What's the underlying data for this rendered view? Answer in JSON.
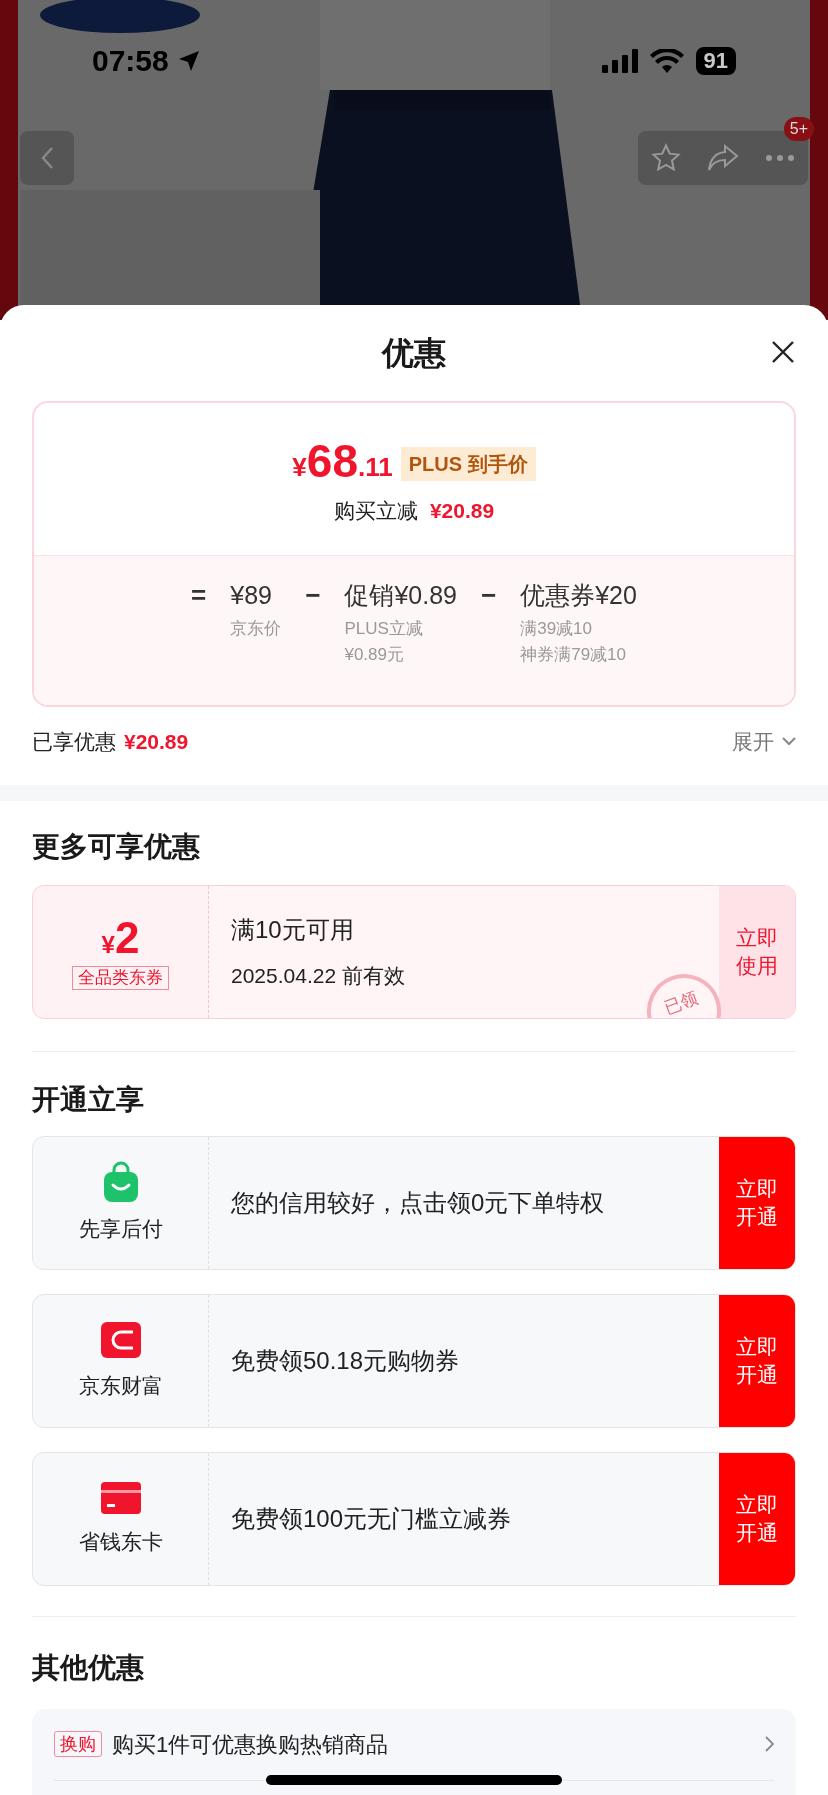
{
  "status_bar": {
    "time": "07:58",
    "battery": "91"
  },
  "nav": {
    "badge": "5+"
  },
  "sheet": {
    "title": "优惠"
  },
  "price_card": {
    "currency": "¥",
    "price_int": "68",
    "price_dec": ".11",
    "price_tag": "PLUS 到手价",
    "reduction_label": "购买立减",
    "reduction": "¥20.89",
    "breakdown": [
      {
        "op": "=",
        "amount": "¥89",
        "notes": [
          "京东价"
        ]
      },
      {
        "op": "−",
        "amount": "促销¥0.89",
        "notes": [
          "PLUS立减",
          "¥0.89元"
        ]
      },
      {
        "op": "−",
        "amount": "优惠券¥20",
        "notes": [
          "满39减10",
          "神券满79减10"
        ]
      }
    ]
  },
  "enjoyed": {
    "label": "已享优惠",
    "amount": "¥20.89",
    "toggle": "展开"
  },
  "more": {
    "heading": "更多可享优惠",
    "coupon": {
      "currency": "¥",
      "amount": "2",
      "scope": "全品类东券",
      "condition": "满10元可用",
      "expiry": "2025.04.22 前有效",
      "stamp": "已领",
      "action": "立即使用"
    }
  },
  "open": {
    "heading": "开通立享",
    "services": [
      {
        "kind": "bag",
        "name": "先享后付",
        "text": "您的信用较好，点击领0元下单特权",
        "action": "立即开通"
      },
      {
        "kind": "wallet",
        "name": "京东财富",
        "text": "免费领50.18元购物券",
        "action": "立即开通"
      },
      {
        "kind": "card",
        "name": "省钱东卡",
        "text": "免费领100元无门槛立减券",
        "action": "立即开通"
      }
    ]
  },
  "other": {
    "heading": "其他优惠",
    "items": [
      {
        "tag": "换购",
        "text": "购买1件可优惠换购热销商品"
      }
    ]
  }
}
